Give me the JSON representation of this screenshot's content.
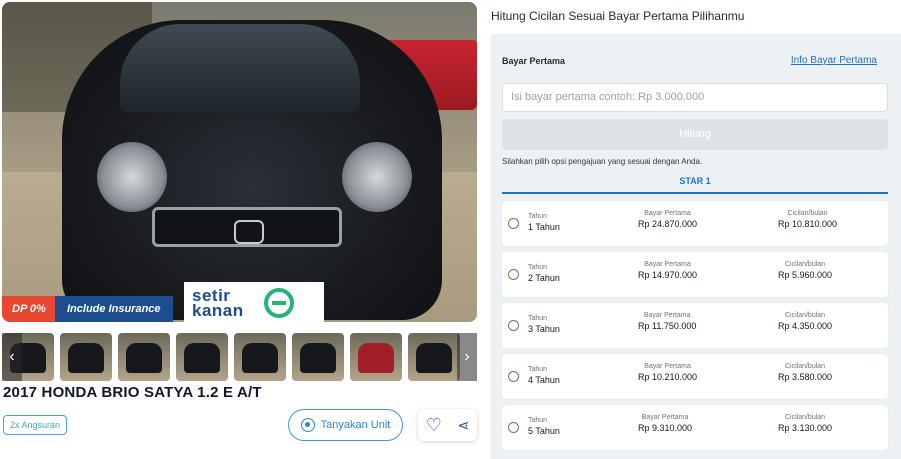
{
  "listing": {
    "title": "2017 HONDA BRIO SATYA 1.2 E A/T",
    "badge_dp": "DP 0%",
    "badge_insurance": "Include Insurance",
    "brand_logo_text": "setir kanan",
    "installment_chip": "2x Angsuran",
    "ask_button": "Tanyakan Unit"
  },
  "thumbnails": {
    "count": 8,
    "prev_glyph": "‹",
    "next_glyph": "›"
  },
  "calculator": {
    "heading": "Hitung Cicilan Sesuai Bayar Pertama Pilihanmu",
    "down_payment_label": "Bayar Pertama",
    "info_link": "Info Bayar Pertama",
    "input_placeholder": "Isi bayar pertama contoh: Rp 3.000.000",
    "submit_label": "Hitung",
    "hint": "Silahkan pilih opsi pengajuan yang sesuai dengan Anda.",
    "tab_label": "STAR 1",
    "col_tenor_label": "Tahun",
    "col_bayar_label": "Bayar Pertama",
    "col_cicilan_label": "Cicilan/bulan",
    "options": [
      {
        "tenor": "1 Tahun",
        "bayar": "Rp 24.870.000",
        "cicilan": "Rp 10.810.000"
      },
      {
        "tenor": "2 Tahun",
        "bayar": "Rp 14.970.000",
        "cicilan": "Rp 5.960.000"
      },
      {
        "tenor": "3 Tahun",
        "bayar": "Rp 11.750.000",
        "cicilan": "Rp 4.350.000"
      },
      {
        "tenor": "4 Tahun",
        "bayar": "Rp 10.210.000",
        "cicilan": "Rp 3.580.000"
      },
      {
        "tenor": "5 Tahun",
        "bayar": "Rp 9.310.000",
        "cicilan": "Rp 3.130.000"
      }
    ]
  },
  "colors": {
    "primary_blue": "#1b74c5",
    "dp_badge": "#e8472f",
    "insurance_badge": "#1b4d8f",
    "logo_green": "#22b573"
  },
  "icons": [
    "whatsapp-icon",
    "heart-icon",
    "share-icon",
    "chevron-left-icon",
    "chevron-right-icon"
  ]
}
